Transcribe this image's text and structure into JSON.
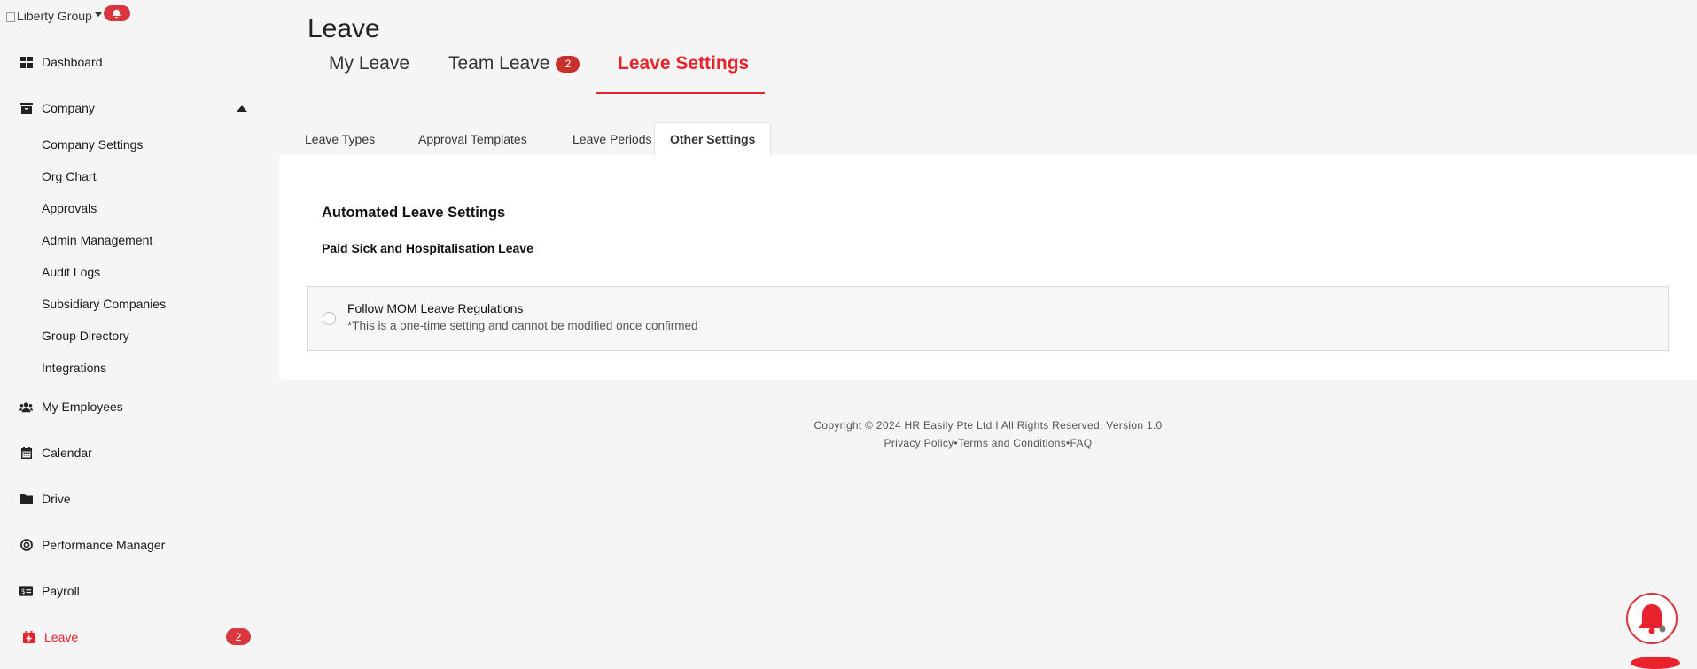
{
  "brand": {
    "alt_text": "Liberty Group"
  },
  "sidebar": {
    "dashboard": "Dashboard",
    "company": "Company",
    "company_sub": [
      "Company Settings",
      "Org Chart",
      "Approvals",
      "Admin Management",
      "Audit Logs",
      "Subsidiary Companies",
      "Group Directory",
      "Integrations"
    ],
    "my_employees": "My Employees",
    "calendar": "Calendar",
    "drive": "Drive",
    "performance": "Performance Manager",
    "payroll": "Payroll",
    "leave": "Leave",
    "leave_badge": "2"
  },
  "page": {
    "title": "Leave"
  },
  "top_tabs": {
    "my_leave": "My Leave",
    "team_leave": "Team Leave",
    "team_leave_badge": "2",
    "leave_settings": "Leave Settings"
  },
  "sub_tabs": {
    "leave_types": "Leave Types",
    "approval_templates": "Approval Templates",
    "leave_periods": "Leave Periods",
    "other_settings": "Other Settings"
  },
  "content": {
    "section_title": "Automated Leave Settings",
    "section_subtitle": "Paid Sick and Hospitalisation Leave",
    "option_label": "Follow MOM Leave Regulations",
    "option_note": "*This is a one-time setting and cannot be modified once confirmed"
  },
  "footer": {
    "copyright": "Copyright © 2024 HR Easily Pte Ltd I All Rights Reserved. Version 1.0",
    "privacy": "Privacy Policy",
    "terms": "Terms and Conditions",
    "faq": "FAQ",
    "separator": "•"
  },
  "colors": {
    "accent": "#e8232c",
    "badge": "#d9363e"
  },
  "icons": [
    "bell-icon",
    "dashboard-icon",
    "archive-icon",
    "users-icon",
    "calendar-icon",
    "folder-icon",
    "target-icon",
    "payroll-icon",
    "calendar-plus-icon"
  ]
}
